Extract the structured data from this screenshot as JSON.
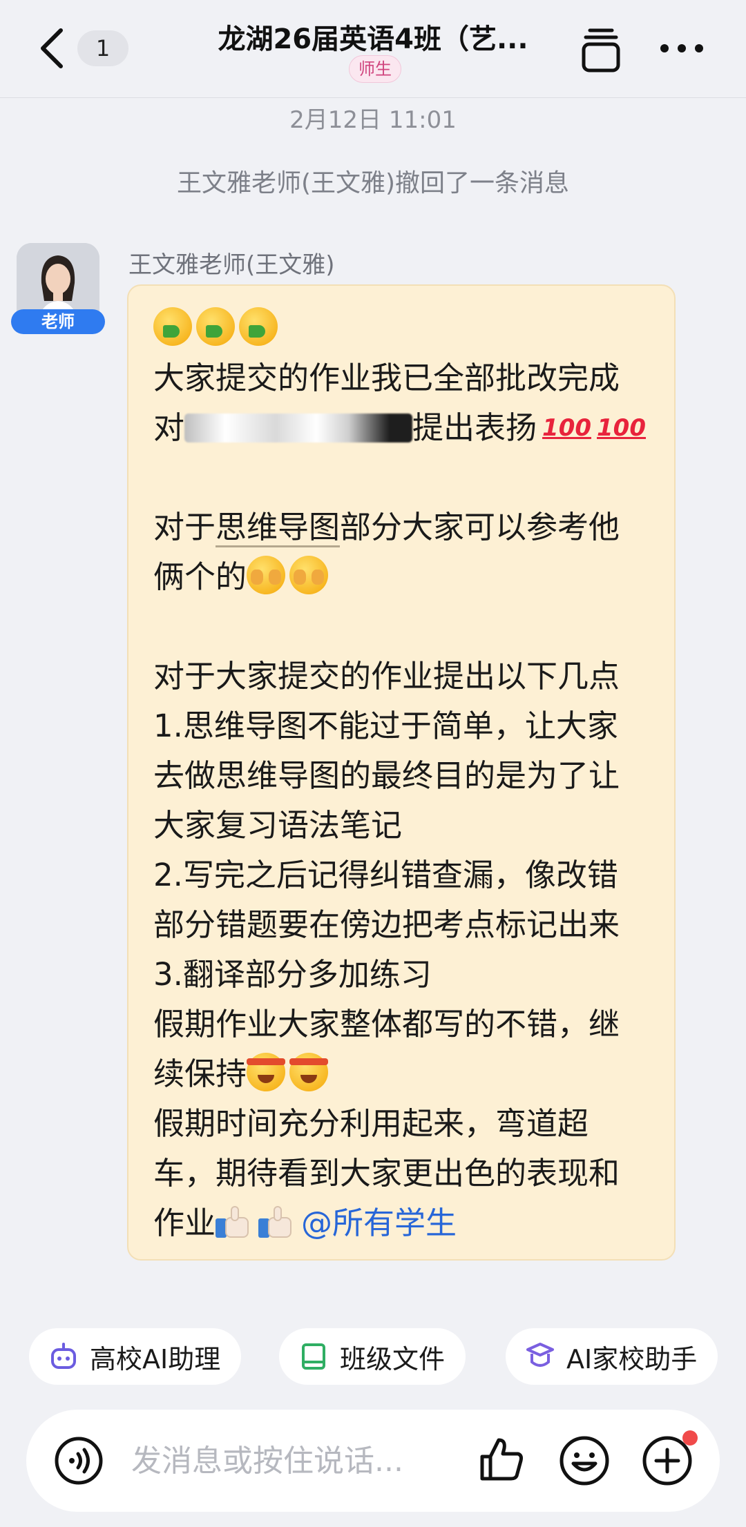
{
  "header": {
    "back_count": "1",
    "title": "龙湖26届英语4班（艺...",
    "role_tag": "师生"
  },
  "chat": {
    "timestamp": "2月12日 11:01",
    "recall_notice": "王文雅老师(王文雅)撤回了一条消息",
    "message": {
      "sender": "王文雅老师(王文雅)",
      "avatar_badge": "老师",
      "line_2": "大家提交的作业我已全部批改完成",
      "line_3_start": "对",
      "line_3_end": "提出表扬",
      "hundred_mark": "100",
      "line_5_pre": "对于",
      "line_5_link": "思维导图",
      "line_5_post": "部分大家可以参考他",
      "line_6": "俩个的",
      "line_8": "对于大家提交的作业提出以下几点",
      "line_9": "1.思维导图不能过于简单，让大家",
      "line_10": "去做思维导图的最终目的是为了让",
      "line_11": "大家复习语法笔记",
      "line_12": "2.写完之后记得纠错查漏，像改错",
      "line_13": "部分错题要在傍边把考点标记出来",
      "line_14": "3.翻译部分多加练习",
      "line_15": "假期作业大家整体都写的不错，继",
      "line_16": "续保持",
      "line_17": "假期时间充分利用起来，弯道超",
      "line_18": "车，期待看到大家更出色的表现和",
      "line_19": "作业",
      "mention": "@所有学生"
    }
  },
  "shortcuts": {
    "ai_assistant": "高校AI助理",
    "class_files": "班级文件",
    "ai_home_school": "AI家校助手"
  },
  "input": {
    "placeholder": "发消息或按住说话..."
  },
  "colors": {
    "bubble_bg": "#fdf0d4",
    "mention": "#2766d8",
    "teacher_badge": "#2f7bf0",
    "notification_dot": "#f04a4a"
  }
}
